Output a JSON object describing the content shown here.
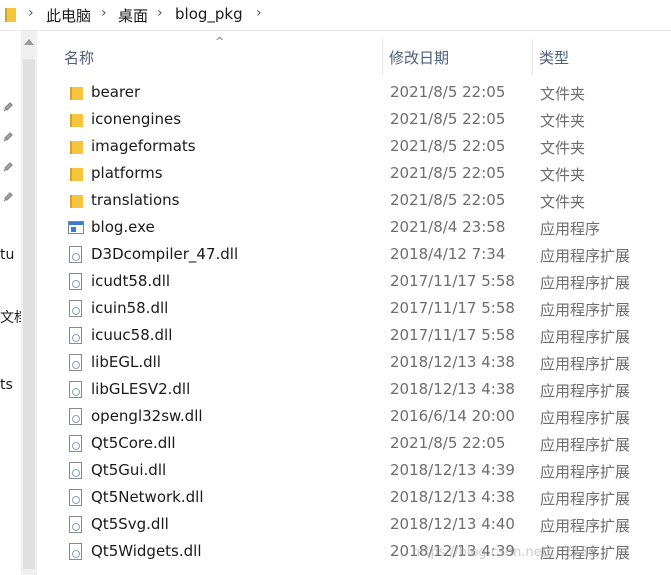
{
  "breadcrumb": [
    "此电脑",
    "桌面",
    "blog_pkg"
  ],
  "columns": {
    "name": "名称",
    "date": "修改日期",
    "type": "类型"
  },
  "nav": {
    "items": [
      "tu",
      "文档",
      "ts"
    ]
  },
  "files": [
    {
      "name": "bearer",
      "date": "2021/8/5 22:05",
      "type": "文件夹",
      "icon": "folder"
    },
    {
      "name": "iconengines",
      "date": "2021/8/5 22:05",
      "type": "文件夹",
      "icon": "folder"
    },
    {
      "name": "imageformats",
      "date": "2021/8/5 22:05",
      "type": "文件夹",
      "icon": "folder"
    },
    {
      "name": "platforms",
      "date": "2021/8/5 22:05",
      "type": "文件夹",
      "icon": "folder"
    },
    {
      "name": "translations",
      "date": "2021/8/5 22:05",
      "type": "文件夹",
      "icon": "folder"
    },
    {
      "name": "blog.exe",
      "date": "2021/8/4 23:58",
      "type": "应用程序",
      "icon": "exe"
    },
    {
      "name": "D3Dcompiler_47.dll",
      "date": "2018/4/12 7:34",
      "type": "应用程序扩展",
      "icon": "dll"
    },
    {
      "name": "icudt58.dll",
      "date": "2017/11/17 5:58",
      "type": "应用程序扩展",
      "icon": "dll"
    },
    {
      "name": "icuin58.dll",
      "date": "2017/11/17 5:58",
      "type": "应用程序扩展",
      "icon": "dll"
    },
    {
      "name": "icuuc58.dll",
      "date": "2017/11/17 5:58",
      "type": "应用程序扩展",
      "icon": "dll"
    },
    {
      "name": "libEGL.dll",
      "date": "2018/12/13 4:38",
      "type": "应用程序扩展",
      "icon": "dll"
    },
    {
      "name": "libGLESV2.dll",
      "date": "2018/12/13 4:38",
      "type": "应用程序扩展",
      "icon": "dll"
    },
    {
      "name": "opengl32sw.dll",
      "date": "2016/6/14 20:00",
      "type": "应用程序扩展",
      "icon": "dll"
    },
    {
      "name": "Qt5Core.dll",
      "date": "2021/8/5 22:05",
      "type": "应用程序扩展",
      "icon": "dll"
    },
    {
      "name": "Qt5Gui.dll",
      "date": "2018/12/13 4:39",
      "type": "应用程序扩展",
      "icon": "dll"
    },
    {
      "name": "Qt5Network.dll",
      "date": "2018/12/13 4:38",
      "type": "应用程序扩展",
      "icon": "dll"
    },
    {
      "name": "Qt5Svg.dll",
      "date": "2018/12/13 4:40",
      "type": "应用程序扩展",
      "icon": "dll"
    },
    {
      "name": "Qt5Widgets.dll",
      "date": "2018/12/13 4:39",
      "type": "应用程序扩展",
      "icon": "dll"
    }
  ],
  "watermark": "https://blog.csdn.net/...2138",
  "colors": {
    "folder": "#f5c542",
    "header_text": "#4c607a",
    "meta_text": "#6d6d6d"
  }
}
